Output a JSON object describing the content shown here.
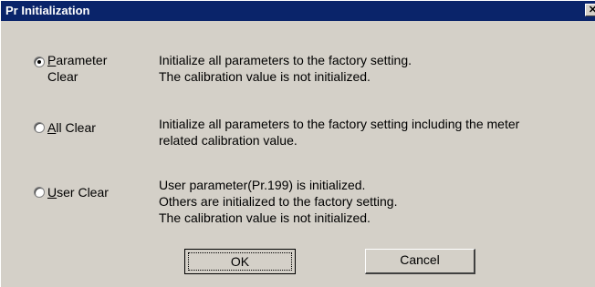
{
  "window": {
    "title": "Pr Initialization",
    "close_icon": "close-icon",
    "close_glyph": "✕"
  },
  "options": [
    {
      "id": "parameter-clear",
      "label_mnemonic": "P",
      "label_rest_line1": "arameter",
      "label_line2": "Clear",
      "checked": true,
      "description": [
        "Initialize all parameters to the factory setting.",
        "The calibration value is not initialized."
      ]
    },
    {
      "id": "all-clear",
      "label_mnemonic": "A",
      "label_rest_line1": "ll Clear",
      "checked": false,
      "description": [
        "Initialize all parameters to the factory setting including the meter",
        "related calibration value."
      ]
    },
    {
      "id": "user-clear",
      "label_mnemonic": "U",
      "label_rest_line1": "ser Clear",
      "checked": false,
      "description": [
        "User parameter(Pr.199) is initialized.",
        "Others are initialized to the factory setting.",
        "The calibration value is not initialized."
      ]
    }
  ],
  "buttons": {
    "ok": "OK",
    "cancel": "Cancel"
  },
  "colors": {
    "titlebar": "#0a246a",
    "dialog_bg": "#d4d0c8"
  }
}
